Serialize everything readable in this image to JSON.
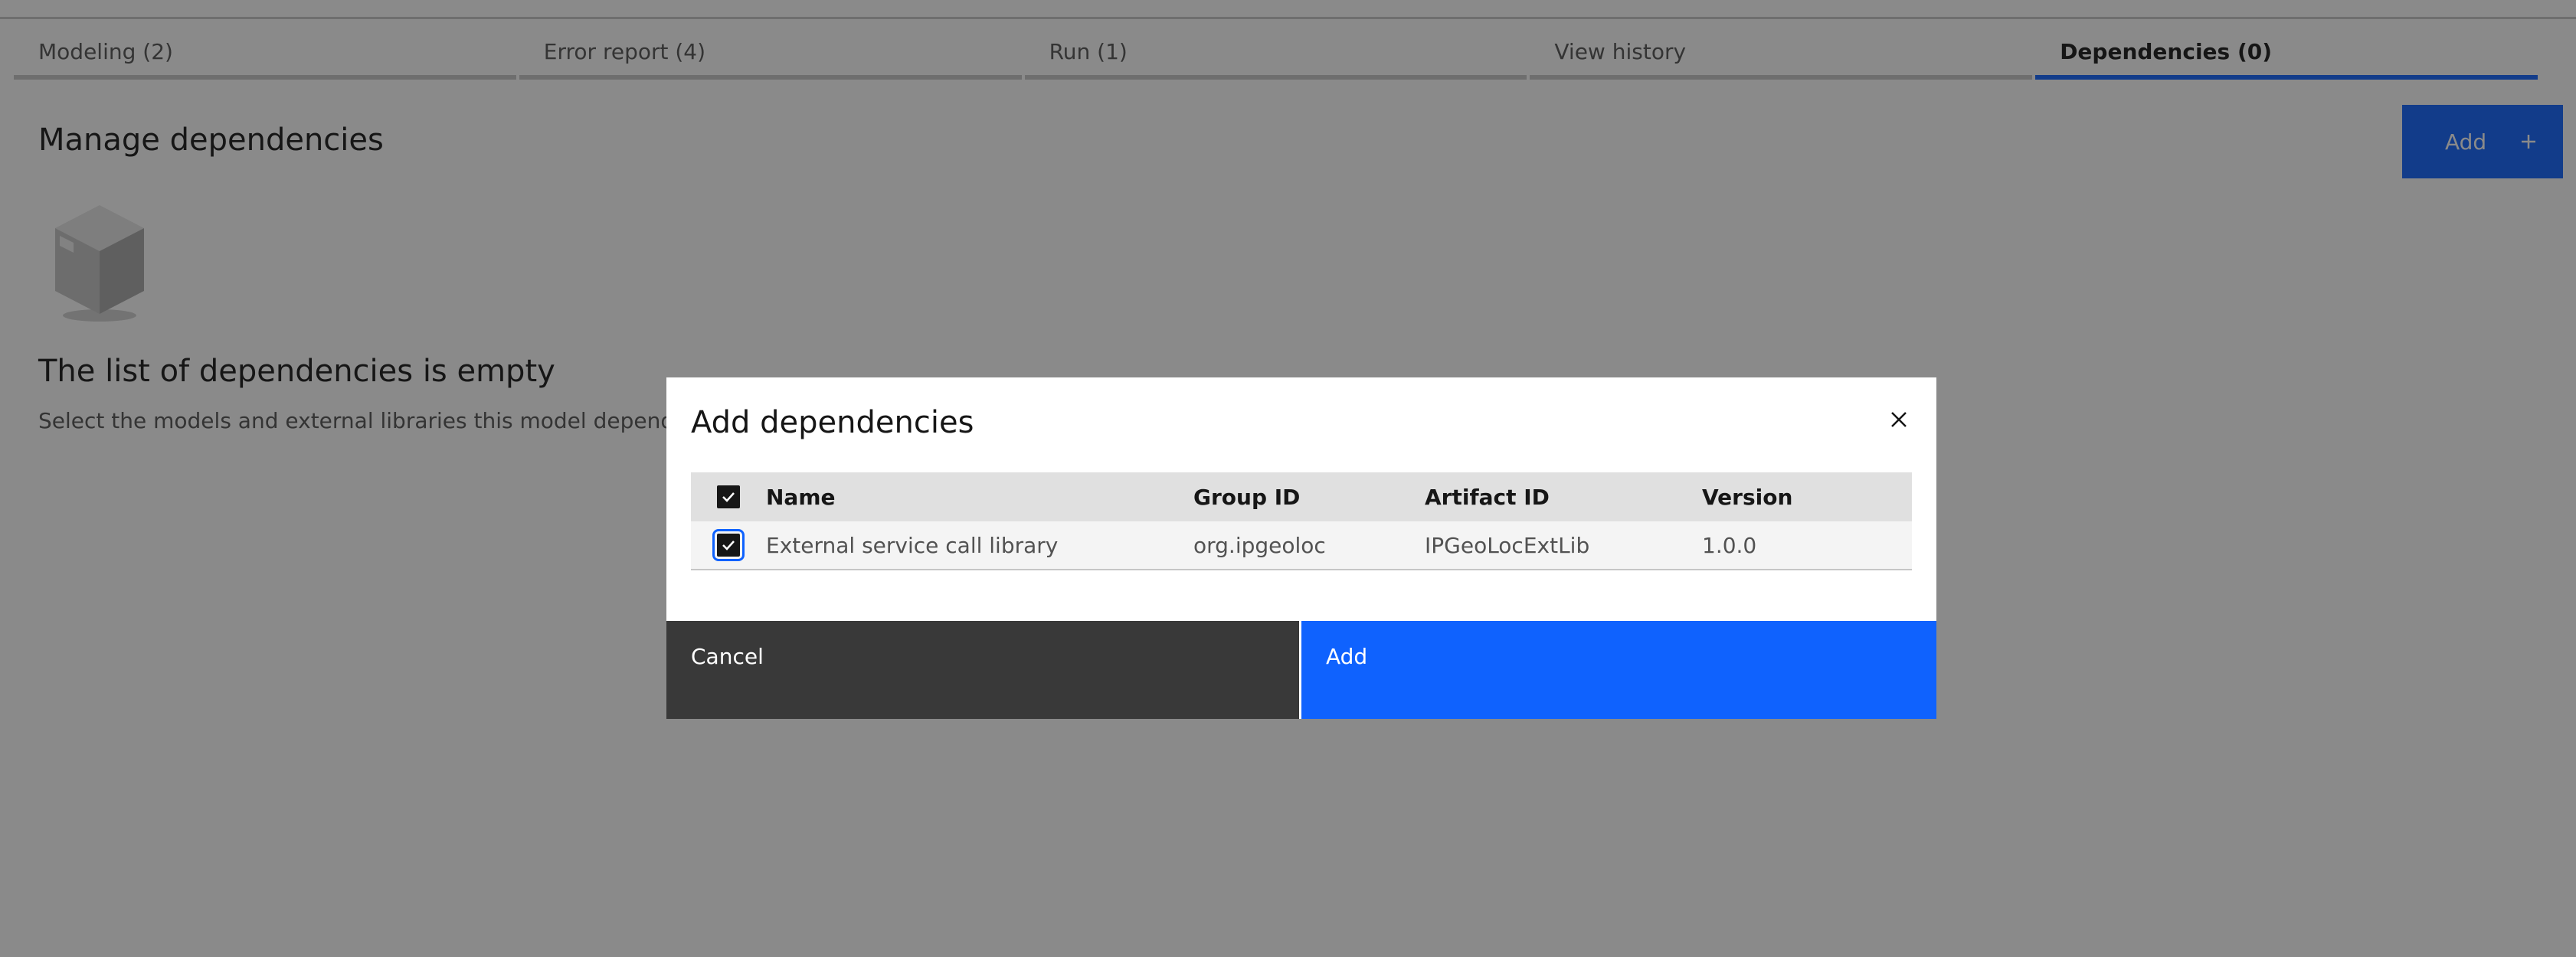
{
  "tabs": [
    {
      "label": "Modeling (2)",
      "active": false
    },
    {
      "label": "Error report (4)",
      "active": false
    },
    {
      "label": "Run (1)",
      "active": false
    },
    {
      "label": "View history",
      "active": false
    },
    {
      "label": "Dependencies (0)",
      "active": true
    }
  ],
  "page": {
    "title": "Manage dependencies",
    "add_button_label": "Add",
    "add_button_icon": "plus-icon",
    "empty_icon": "package-box-icon",
    "empty_title": "The list of dependencies is empty",
    "empty_subtitle": "Select the models and external libraries this model depends on."
  },
  "modal": {
    "title": "Add dependencies",
    "close_icon": "close-icon",
    "table": {
      "header_checked": true,
      "columns": [
        "Name",
        "Group ID",
        "Artifact ID",
        "Version"
      ],
      "rows": [
        {
          "checked": true,
          "name": "External service call library",
          "group_id": "org.ipgeoloc",
          "artifact_id": "IPGeoLocExtLib",
          "version": "1.0.0"
        }
      ]
    },
    "cancel_label": "Cancel",
    "add_label": "Add"
  },
  "colors": {
    "primary": "#0f62fe",
    "secondary_button": "#393939",
    "overlay": "#161616"
  }
}
